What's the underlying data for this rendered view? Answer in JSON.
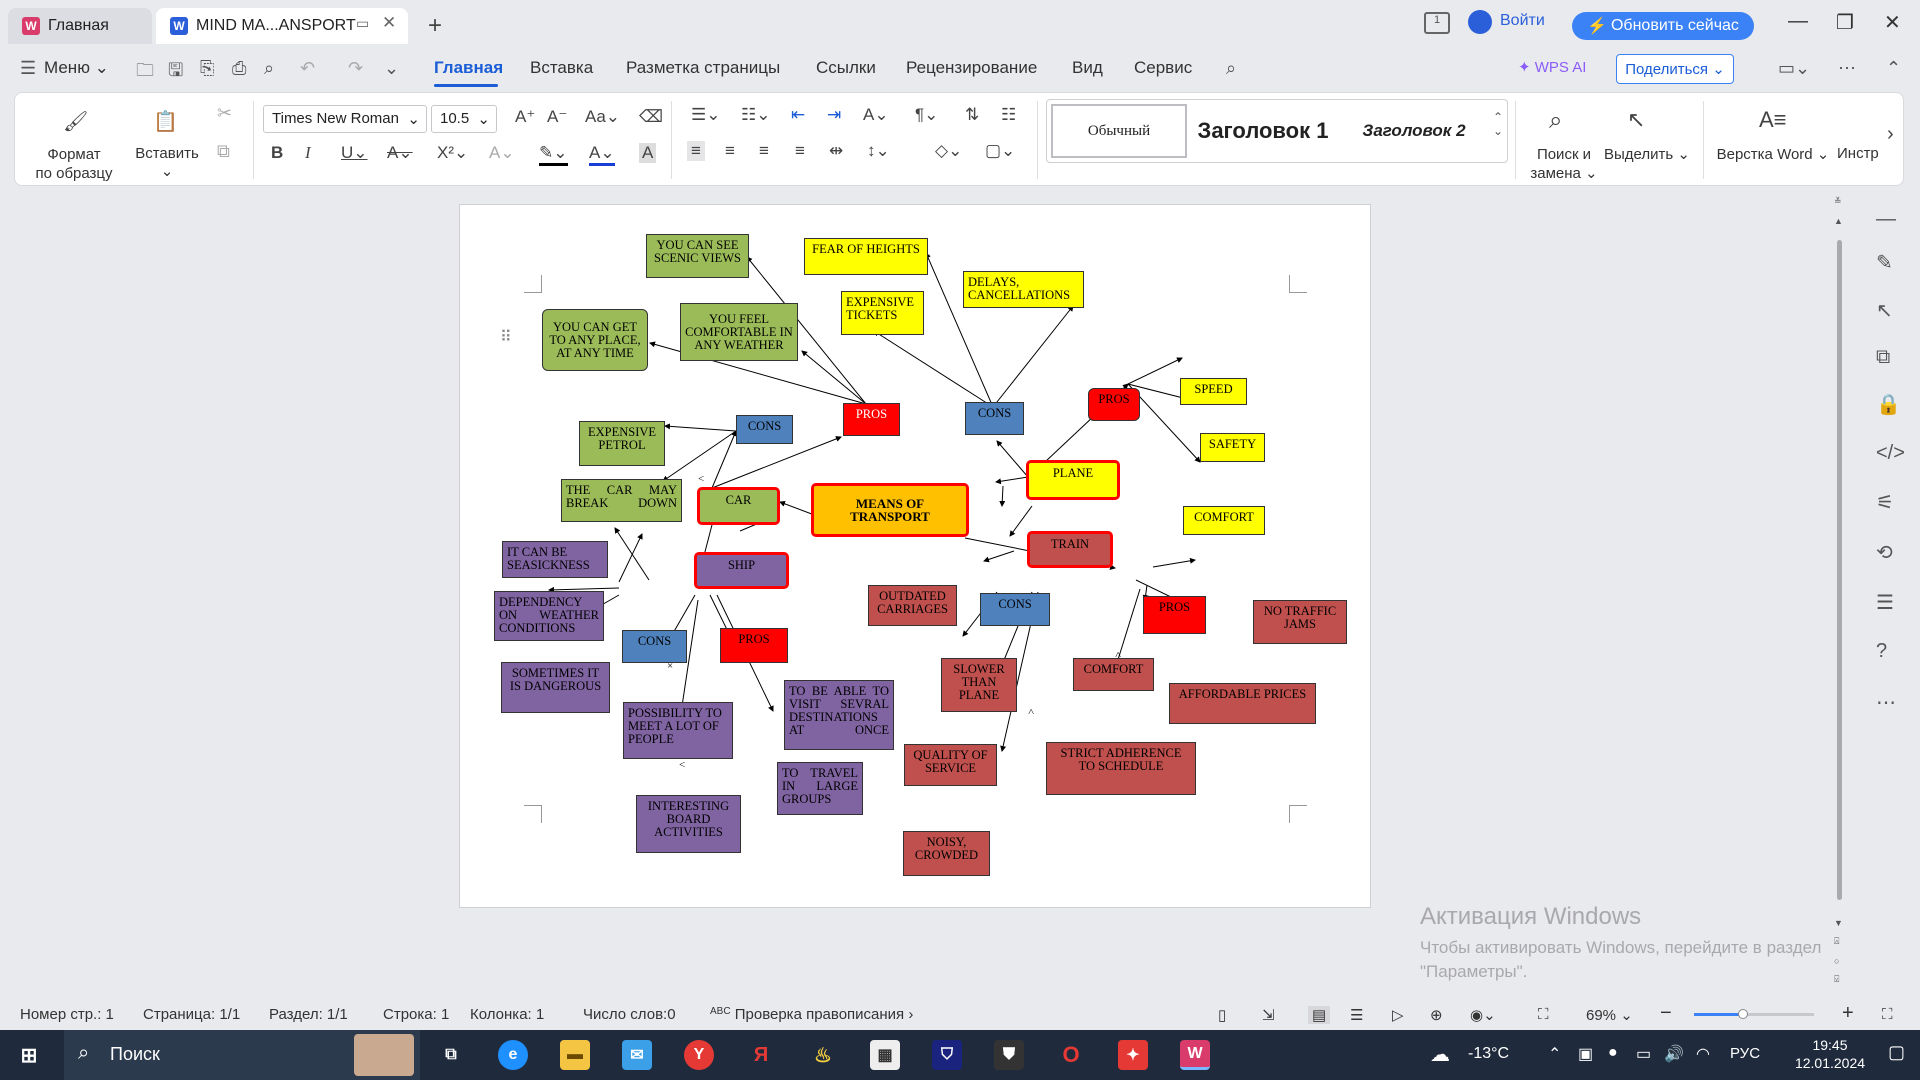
{
  "titlebar": {
    "home_tab": "Главная",
    "doc_tab": "MIND MA...ANSPORT",
    "login": "Войти",
    "update": "Обновить сейчас"
  },
  "menubar": {
    "menu": "Меню",
    "items": [
      "Главная",
      "Вставка",
      "Разметка страницы",
      "Ссылки",
      "Рецензирование",
      "Вид",
      "Сервис"
    ],
    "wps_ai": "WPS AI",
    "share": "Поделиться"
  },
  "ribbon": {
    "format_painter": [
      "Формат",
      "по образцу"
    ],
    "paste": "Вставить",
    "font": "Times New Roman",
    "size": "10.5",
    "styles": [
      "Обычный",
      "Заголовок 1",
      "Заголовок 2"
    ],
    "find": [
      "Поиск и",
      "замена"
    ],
    "select": "Выделить",
    "layout": "Верстка Word",
    "tools": "Инстр"
  },
  "mindmap": {
    "nodes": {
      "center": "MEANS OF TRANSPORT",
      "car": "CAR",
      "car_pros": "PROS",
      "car_cons": "CONS",
      "car_pro1": "YOU CAN SEE SCENIC VIEWS",
      "car_pro2": "YOU FEEL COMFORTABLE IN ANY WEATHER",
      "car_pro3": "YOU CAN GET TO ANY PLACE, AT ANY TIME",
      "car_con1": "EXPENSIVE PETROL",
      "car_con2": "THE CAR MAY BREAK DOWN",
      "plane": "PLANE",
      "plane_cons": "CONS",
      "plane_pros": "PROS",
      "plane_con1": "FEAR OF HEIGHTS",
      "plane_con2": "EXPENSIVE TICKETS",
      "plane_con3": "DELAYS, CANCELLATIONS",
      "plane_pro1": "SPEED",
      "plane_pro2": "SAFETY",
      "plane_pro3": "COMFORT",
      "train": "TRAIN",
      "train_cons": "CONS",
      "train_pros": "PROS",
      "train_con1": "OUTDATED CARRIAGES",
      "train_con2": "SLOWER THAN PLANE",
      "train_con3": "QUALITY OF SERVICE",
      "train_con4": "NOISY, CROWDED",
      "train_pro1": "COMFORT",
      "train_pro2": "NO TRAFFIC JAMS",
      "train_pro3": "AFFORDABLE PRICES",
      "train_pro4": "STRICT ADHERENCE TO SCHEDULE",
      "ship": "SHIP",
      "ship_cons": "CONS",
      "ship_pros": "PROS",
      "ship_con1": "IT CAN BE SEASICKNESS",
      "ship_con2": "DEPENDENCY ON WEATHER CONDITIONS",
      "ship_con3": "SOMETIMES IT IS DANGEROUS",
      "ship_pro1": "POSSIBILITY TO MEET A LOT OF PEOPLE",
      "ship_pro2": "TO BE ABLE TO VISIT SEVRAL DESTINATIONS AT ONCE",
      "ship_pro3": "TO TRAVEL IN LARGE GROUPS",
      "ship_pro4": "INTERESTING BOARD ACTIVITIES"
    }
  },
  "watermark": {
    "title": "Активация Windows",
    "sub": "Чтобы активировать Windows, перейдите в раздел \"Параметры\"."
  },
  "status": {
    "page_no": "Номер стр.: 1",
    "page": "Страница: 1/1",
    "section": "Раздел: 1/1",
    "line": "Строка: 1",
    "column": "Колонка: 1",
    "words": "Число слов:0",
    "spell": "Проверка правописания",
    "zoom": "69%"
  },
  "taskbar": {
    "search": "Поиск",
    "temp": "-13°C",
    "lang": "РУС",
    "time": "19:45",
    "date": "12.01.2024"
  },
  "colors": {
    "accent": "#1a5dd6",
    "update_btn": "#3b82f6",
    "taskbar": "#1f2b3c"
  }
}
